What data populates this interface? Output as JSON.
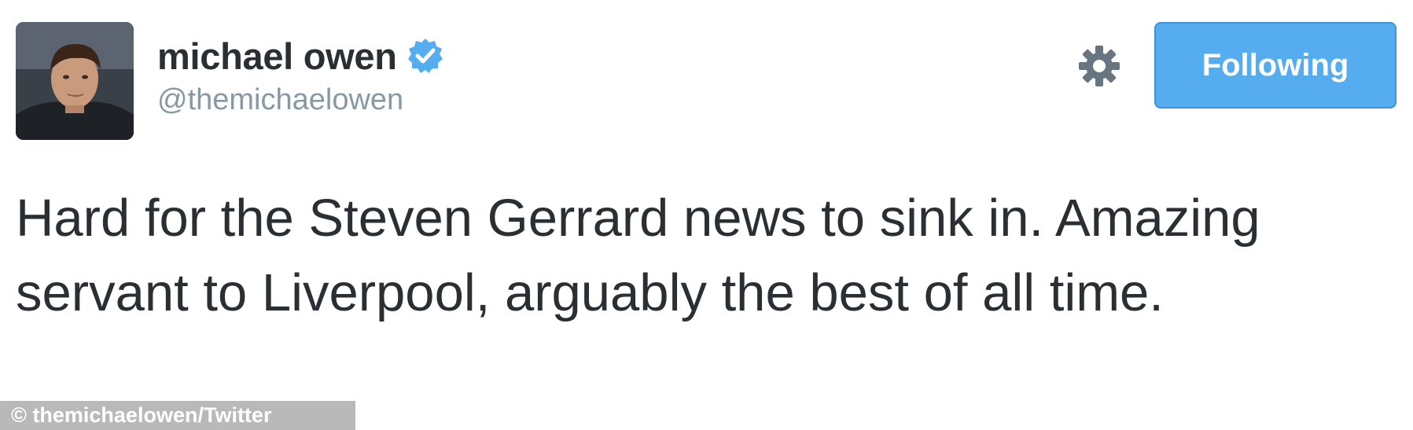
{
  "tweet": {
    "author": {
      "name": "michael owen",
      "handle": "@themichaelowen",
      "verified": true,
      "avatar_icon": "user-avatar-photo"
    },
    "actions": {
      "settings_icon": "gear-icon",
      "follow_label": "Following"
    },
    "text": "Hard for the Steven Gerrard news to sink in. Amazing servant to Liverpool, arguably the best of all time."
  },
  "watermark": "© themichaelowen/Twitter",
  "colors": {
    "follow_button": "#55acee",
    "verified_badge": "#55acee",
    "handle_text": "#8899a6",
    "body_text": "#292f33",
    "gear": "#66757f"
  }
}
